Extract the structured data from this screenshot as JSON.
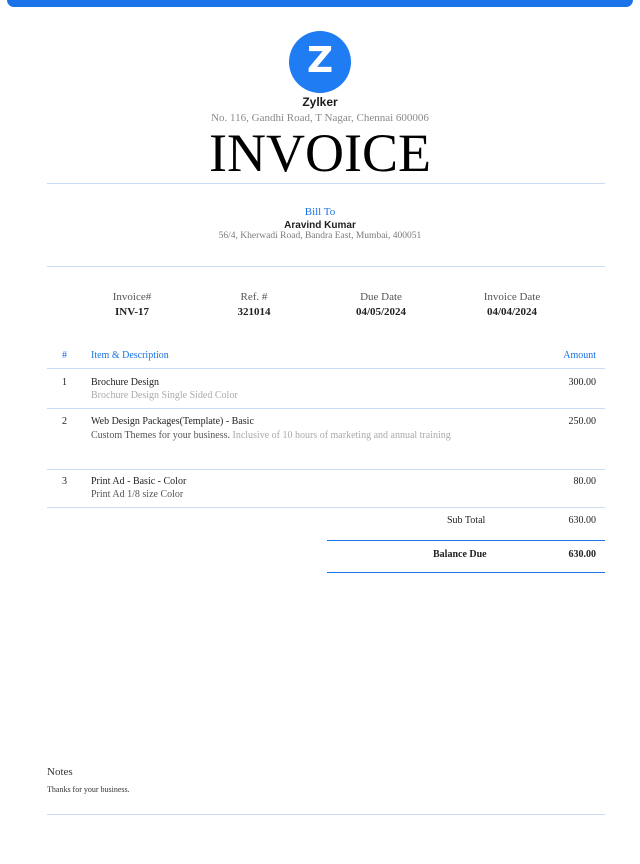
{
  "brand": {
    "logo_letter": "Z",
    "accent": "#1a73e8",
    "logo_color": "#1f7cf2"
  },
  "company": {
    "name": "Zylker",
    "address": "No. 116, Gandhi Road, T Nagar, Chennai 600006"
  },
  "document": {
    "title": "INVOICE"
  },
  "bill_to": {
    "label": "Bill To",
    "name": "Aravind Kumar",
    "address": "56/4, Kherwadi Road, Bandra East, Mumbai, 400051"
  },
  "meta": [
    {
      "label": "Invoice#",
      "value": "INV-17"
    },
    {
      "label": "Ref. #",
      "value": "321014"
    },
    {
      "label": "Due Date",
      "value": "04/05/2024"
    },
    {
      "label": "Invoice Date",
      "value": "04/04/2024"
    }
  ],
  "table": {
    "headers": {
      "num": "#",
      "item": "Item & Description",
      "amount": "Amount"
    },
    "rows": [
      {
        "num": "1",
        "name": "Brochure Design",
        "desc": "",
        "desc_light": "Brochure Design Single Sided Color",
        "amount": "300.00"
      },
      {
        "num": "2",
        "name": "Web Design Packages(Template) - Basic",
        "desc": "Custom Themes for your business.",
        "desc_light": "Inclusive of 10 hours of marketing and annual training",
        "amount": "250.00"
      },
      {
        "num": "3",
        "name": "Print Ad - Basic - Color",
        "desc": "Print Ad 1/8 size Color",
        "desc_light": "",
        "amount": "80.00"
      }
    ]
  },
  "totals": {
    "sub_total_label": "Sub Total",
    "sub_total": "630.00",
    "balance_due_label": "Balance Due",
    "balance_due": "630.00"
  },
  "notes": {
    "title": "Notes",
    "text": "Thanks for your business."
  }
}
